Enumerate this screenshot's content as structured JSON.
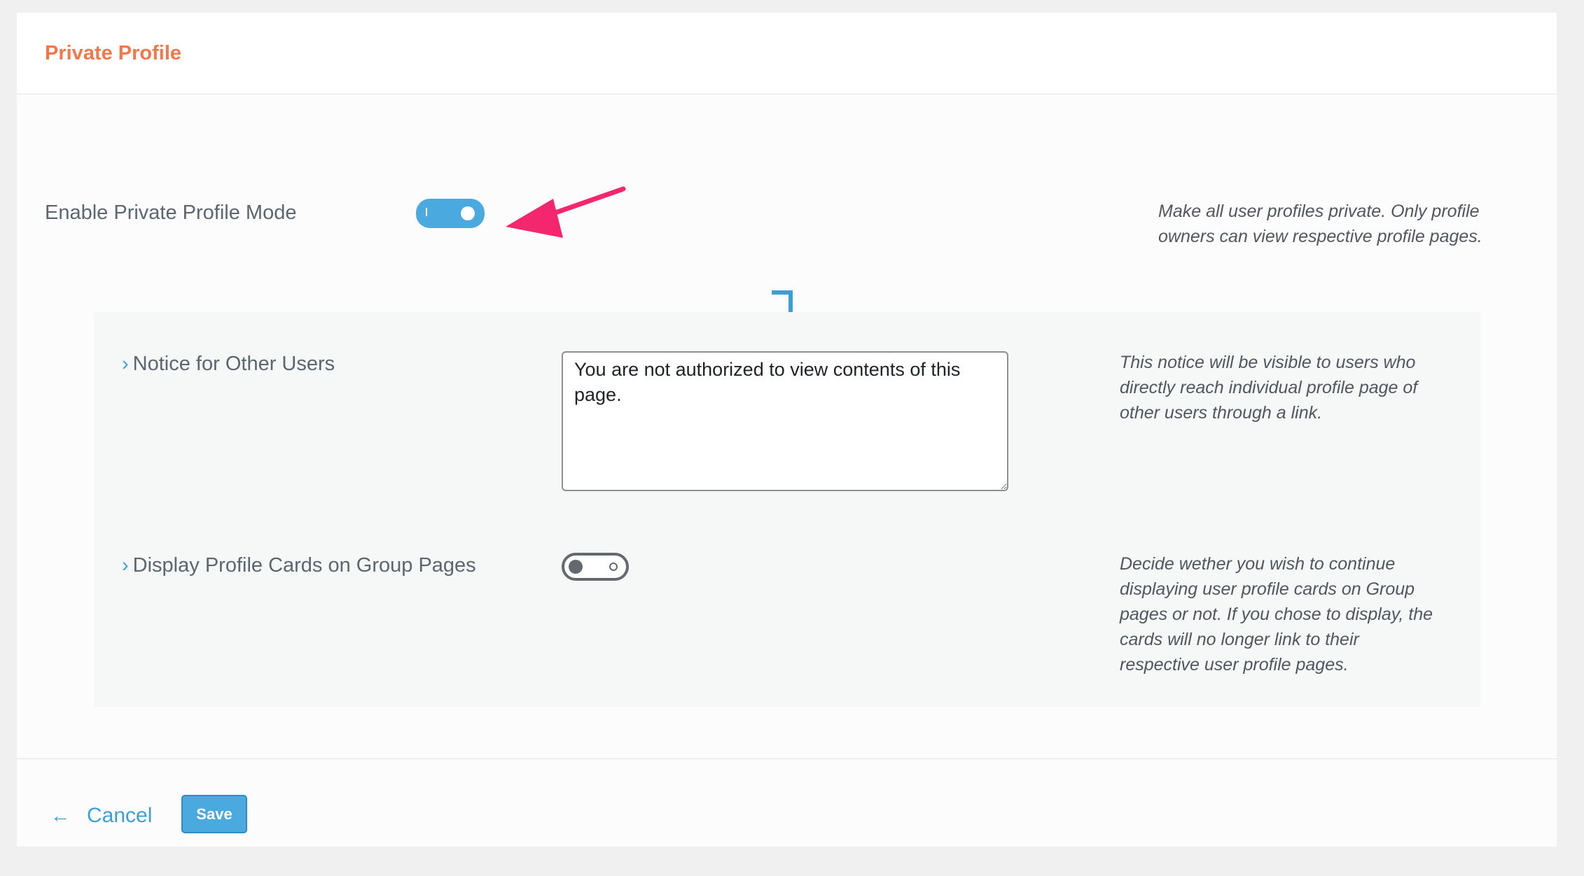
{
  "header": {
    "title": "Private Profile"
  },
  "settings": {
    "enable_private": {
      "label": "Enable Private Profile Mode",
      "enabled": true,
      "description_line1": "Make all user profiles private. Only profile",
      "description_line2": "owners can view respective profile pages."
    },
    "notice": {
      "label": "Notice for Other Users",
      "value": "You are not authorized to view contents of this page.",
      "description_line1": "This notice will be visible to users who",
      "description_line2": "directly reach individual profile page of",
      "description_line3": "other users through a link."
    },
    "group_cards": {
      "label": "Display Profile Cards on Group Pages",
      "enabled": false,
      "description_line1": "Decide wether you wish to continue",
      "description_line2": "displaying user profile cards on Group",
      "description_line3": "pages or not. If you chose to display, the",
      "description_line4": "cards will no longer link to their",
      "description_line5": "respective user profile pages."
    }
  },
  "footer": {
    "cancel_label": "Cancel",
    "save_label": "Save"
  },
  "colors": {
    "accent": "#4aa9df",
    "title": "#f2774b",
    "annotation_arrow": "#f3266e"
  },
  "icons": {
    "chevron": "chevron-right-icon",
    "cancel": "arrow-left-icon",
    "connector": "corner-down-arrow-icon",
    "annotation": "pointer-arrow-icon"
  }
}
